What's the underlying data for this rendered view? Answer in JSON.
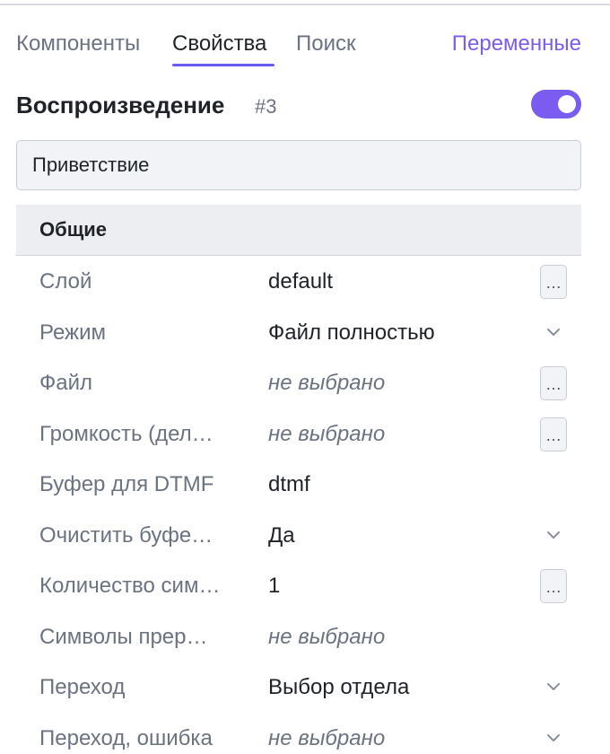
{
  "tabs": [
    {
      "label": "Компоненты"
    },
    {
      "label": "Свойства"
    },
    {
      "label": "Поиск"
    }
  ],
  "variables_tab": "Переменные",
  "active_tab": "Свойства",
  "block": {
    "title": "Воспроизведение",
    "id": "#3",
    "enabled": true,
    "name": "Приветствие"
  },
  "section": {
    "title": "Общие"
  },
  "properties": [
    {
      "label": "Слой",
      "value": "default",
      "control": "more"
    },
    {
      "label": "Режим",
      "value": "Файл полностью",
      "control": "dropdown"
    },
    {
      "label": "Файл",
      "value": "не выбрано",
      "control": "more"
    },
    {
      "label": "Громкость (дел…",
      "value": "не выбрано",
      "control": "more"
    },
    {
      "label": "Буфер для DTMF",
      "value": "dtmf",
      "control": "none"
    },
    {
      "label": "Очистить буфе…",
      "value": "Да",
      "control": "dropdown"
    },
    {
      "label": "Количество сим…",
      "value": "1",
      "control": "more"
    },
    {
      "label": "Символы прер…",
      "value": "не выбрано",
      "control": "none"
    },
    {
      "label": "Переход",
      "value": "Выбор отдела",
      "control": "dropdown"
    },
    {
      "label": "Переход, ошибка",
      "value": "не выбрано",
      "control": "dropdown"
    }
  ],
  "more_button_label": "…",
  "colors": {
    "accent": "#7a5cf0",
    "muted_text": "#6b7280",
    "section_bg": "#eceef1"
  }
}
